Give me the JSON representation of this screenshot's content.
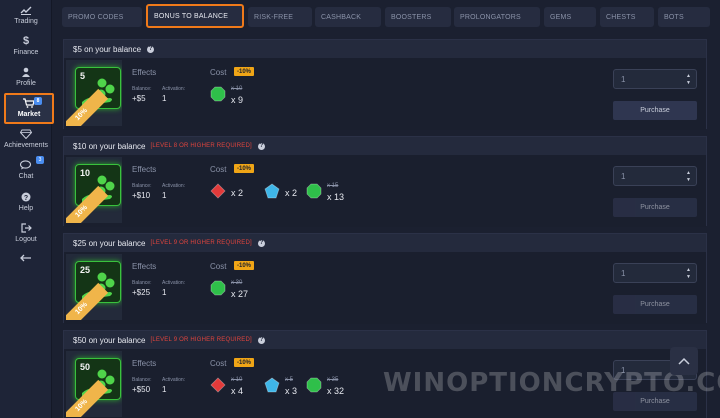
{
  "sidebar": {
    "items": [
      {
        "label": "Trading",
        "icon": "trading-chart-icon"
      },
      {
        "label": "Finance",
        "icon": "dollar-icon"
      },
      {
        "label": "Profile",
        "icon": "user-icon"
      },
      {
        "label": "Market",
        "icon": "cart-icon",
        "badge": "8"
      },
      {
        "label": "Achievements",
        "icon": "diamond-icon"
      },
      {
        "label": "Chat",
        "icon": "chat-icon",
        "badge": "3"
      },
      {
        "label": "Help",
        "icon": "help-icon"
      },
      {
        "label": "Logout",
        "icon": "logout-icon"
      }
    ],
    "collapse_icon": "arrow-left-icon"
  },
  "tabs": [
    {
      "label": "PROMO CODES"
    },
    {
      "label": "BONUS TO BALANCE",
      "active": true
    },
    {
      "label": "RISK-FREE"
    },
    {
      "label": "CASHBACK"
    },
    {
      "label": "BOOSTERS"
    },
    {
      "label": "PROLONGATORS"
    },
    {
      "label": "GEMS"
    },
    {
      "label": "CHESTS"
    },
    {
      "label": "BOTS"
    }
  ],
  "labels": {
    "effects": "Effects",
    "balance": "Balance:",
    "activation": "Activation:",
    "cost": "Cost",
    "purchase": "Purchase"
  },
  "colors": {
    "accent_orange": "#f07a1a",
    "requirement_red": "#e0443d",
    "discount_badge": "#f0a516",
    "gem_red": "#e23a3a",
    "gem_blue": "#3fb6e8",
    "gem_green": "#2fbf4a"
  },
  "offers": [
    {
      "title": "$5 on your balance",
      "requirement": "",
      "icon_value": "5",
      "discount_ribbon": "10%",
      "balance": "+$5",
      "activation": "1",
      "cost_discount": "-10%",
      "gems": [
        {
          "color": "green",
          "old": "x 10",
          "qty": "x 9"
        }
      ],
      "quantity": "1",
      "purchase_state": "active"
    },
    {
      "title": "$10 on your balance",
      "requirement": "[LEVEL 8 OR HIGHER REQUIRED]",
      "icon_value": "10",
      "discount_ribbon": "10%",
      "balance": "+$10",
      "activation": "1",
      "cost_discount": "-10%",
      "gems": [
        {
          "color": "red",
          "old": "",
          "qty": "x 2"
        },
        {
          "color": "blue",
          "old": "",
          "qty": "x 2"
        },
        {
          "color": "green",
          "old": "x 15",
          "qty": "x 13"
        }
      ],
      "quantity": "1",
      "purchase_state": "disabled"
    },
    {
      "title": "$25 on your balance",
      "requirement": "[LEVEL 9 OR HIGHER REQUIRED]",
      "icon_value": "25",
      "discount_ribbon": "10%",
      "balance": "+$25",
      "activation": "1",
      "cost_discount": "-10%",
      "gems": [
        {
          "color": "green",
          "old": "x 30",
          "qty": "x 27"
        }
      ],
      "quantity": "1",
      "purchase_state": "disabled"
    },
    {
      "title": "$50 on your balance",
      "requirement": "[LEVEL 9 OR HIGHER REQUIRED]",
      "icon_value": "50",
      "discount_ribbon": "10%",
      "balance": "+$50",
      "activation": "1",
      "cost_discount": "-10%",
      "gems": [
        {
          "color": "red",
          "old": "x 10",
          "qty": "x 4"
        },
        {
          "color": "blue",
          "old": "x 5",
          "qty": "x 3"
        },
        {
          "color": "green",
          "old": "x 35",
          "qty": "x 32"
        }
      ],
      "quantity": "1",
      "purchase_state": "disabled"
    }
  ],
  "watermark": "WINOPTIONCRYPTO.COM"
}
